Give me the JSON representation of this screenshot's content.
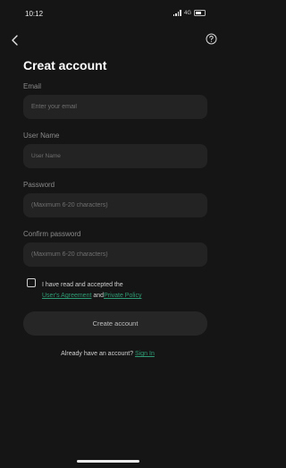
{
  "status_bar": {
    "time": "10:12",
    "network": "4G"
  },
  "header": {
    "title": "Creat account",
    "back_icon": "chevron-left-icon",
    "help_icon": "question-circle-icon"
  },
  "form": {
    "email": {
      "label": "Email",
      "placeholder": "Enter your email",
      "value": ""
    },
    "username": {
      "label": "User Name",
      "placeholder": "User Name",
      "value": ""
    },
    "password": {
      "label": "Password",
      "placeholder": "(Maximum 6-20 characters)",
      "value": ""
    },
    "confirm_password": {
      "label": "Confirm password",
      "placeholder": "(Maximum 6-20 characters)",
      "value": ""
    }
  },
  "agreement": {
    "text": "I have read and accepted the",
    "users_agreement": "User's Agreement",
    "and": "and",
    "privacy_policy": "Private Policy",
    "checked": false
  },
  "submit_label": "Create account",
  "signin": {
    "prompt": "Already have an account?",
    "link": "Sign In"
  },
  "colors": {
    "background": "#151515",
    "field": "#232323",
    "link": "#2f9b74"
  }
}
